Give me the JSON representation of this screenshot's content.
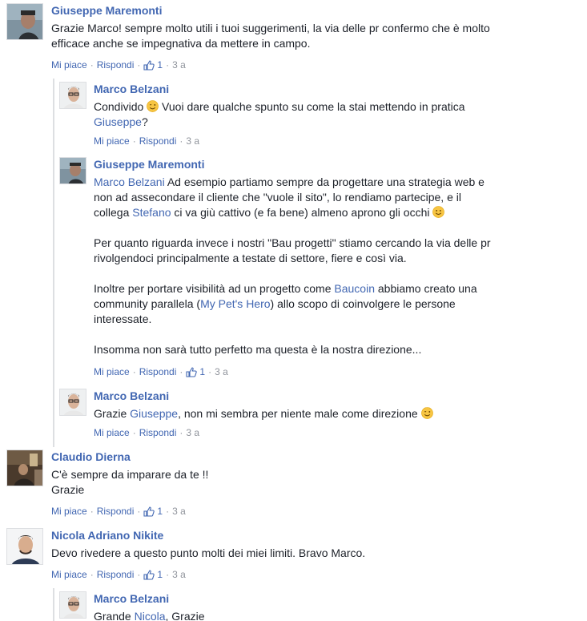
{
  "comments": [
    {
      "author": "Giuseppe Maremonti",
      "lines": [
        "Grazie Marco! sempre molto utili i tuoi suggerimenti, la via delle pr confermo che è molto",
        "efficace anche se impegnativa da mettere in campo."
      ],
      "like_label": "Mi piace",
      "reply_label": "Rispondi",
      "likes": "1",
      "time": "3 a"
    },
    {
      "author": "Marco Belzani",
      "line1_a": "Condivido",
      "line1_b": "Vuoi dare qualche spunto su come la stai mettendo in pratica",
      "line2_link": "Giuseppe",
      "line2_tail": "?",
      "like_label": "Mi piace",
      "reply_label": "Rispondi",
      "time": "3 a"
    },
    {
      "author": "Giuseppe Maremonti",
      "p1_link": "Marco Belzani",
      "p1_a": " Ad esempio partiamo sempre da progettare una strategia web e",
      "p1_b": "non ad assecondare il cliente che \"vuole il sito\", lo rendiamo partecipe, e il",
      "p1_c_pre": "collega ",
      "p1_c_link": "Stefano",
      "p1_c_post": " ci va giù cattivo (e fa bene) almeno aprono gli occhi",
      "p2_a": "Per quanto riguarda invece i nostri \"Bau progetti\" stiamo cercando la via delle pr",
      "p2_b": "rivolgendoci principalmente a testate di settore, fiere e così via.",
      "p3_a_pre": "Inoltre per portare visibilità ad un progetto come ",
      "p3_a_link": "Baucoin",
      "p3_a_post": " abbiamo creato una",
      "p3_b_pre": "community parallela (",
      "p3_b_link": "My Pet's Hero",
      "p3_b_post": ") allo scopo di coinvolgere le persone",
      "p3_c": "interessate.",
      "p4": "Insomma non sarà tutto perfetto ma questa è la nostra direzione...",
      "like_label": "Mi piace",
      "reply_label": "Rispondi",
      "likes": "1",
      "time": "3 a"
    },
    {
      "author": "Marco Belzani",
      "pre": "Grazie ",
      "link": "Giuseppe",
      "post": ", non mi sembra per niente male come direzione",
      "like_label": "Mi piace",
      "reply_label": "Rispondi",
      "time": "3 a"
    },
    {
      "author": "Claudio Dierna",
      "lines": [
        "C'è sempre da imparare da te !!",
        "Grazie"
      ],
      "like_label": "Mi piace",
      "reply_label": "Rispondi",
      "likes": "1",
      "time": "3 a"
    },
    {
      "author": "Nicola Adriano Nikite",
      "text": "Devo rivedere a questo punto molti dei miei limiti. Bravo Marco.",
      "like_label": "Mi piace",
      "reply_label": "Rispondi",
      "likes": "1",
      "time": "3 a"
    },
    {
      "author": "Marco Belzani",
      "pre": "Grande ",
      "link": "Nicola",
      "post": ", Grazie"
    }
  ],
  "colors": {
    "link": "#4267b2",
    "meta": "#90949c",
    "text": "#1d2129"
  }
}
